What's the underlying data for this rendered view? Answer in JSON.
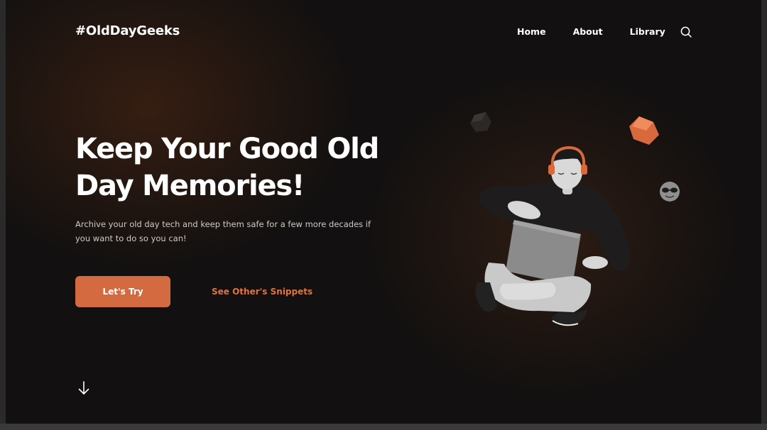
{
  "brand": {
    "logo_text": "#OldDayGeeks"
  },
  "nav": {
    "items": [
      {
        "label": "Home"
      },
      {
        "label": "About"
      },
      {
        "label": "Library"
      }
    ],
    "search_icon": "search-icon"
  },
  "hero": {
    "title": "Keep Your Good Old Day Memories!",
    "description": "Archive your old day tech and keep them safe for a few more decades if you want to do so you can!",
    "primary_button_label": "Let's Try",
    "secondary_link_label": "See Other's Snippets",
    "scroll_icon": "arrow-down-icon"
  },
  "illustration": {
    "subject": "3d-character-with-laptop",
    "decorations": [
      "dark-cube-icon",
      "orange-cube-icon",
      "sunglasses-emoji-icon"
    ]
  },
  "colors": {
    "background": "#121010",
    "accent": "#d46a3f",
    "text": "#ffffff",
    "muted_text": "#cfcac6"
  }
}
